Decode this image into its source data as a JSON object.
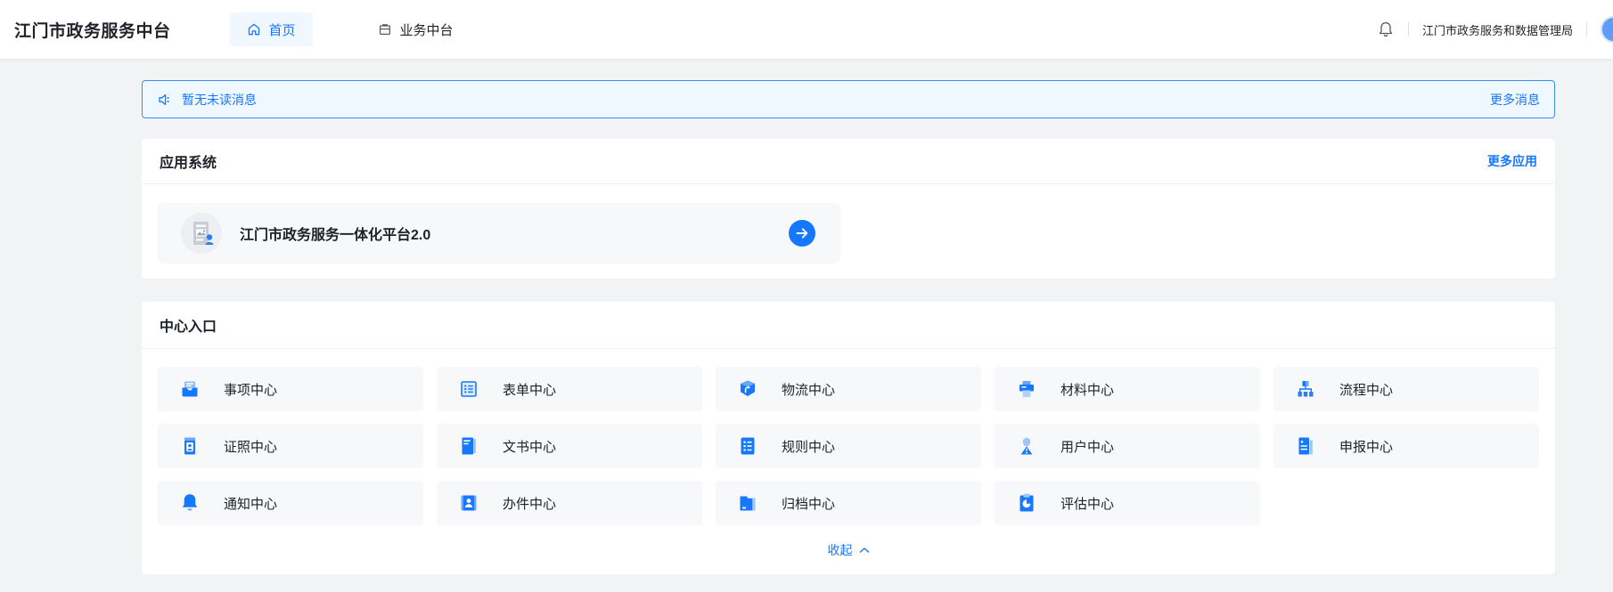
{
  "header": {
    "title": "江门市政务服务中台",
    "nav": [
      {
        "label": "首页",
        "icon": "home-icon",
        "active": true
      },
      {
        "label": "业务中台",
        "icon": "briefcase-icon",
        "active": false
      }
    ],
    "org_name": "江门市政务服务和数据管理局"
  },
  "notice_bar": {
    "message": "暂无未读消息",
    "more_label": "更多消息"
  },
  "app_section": {
    "title": "应用系统",
    "more_label": "更多应用",
    "apps": [
      {
        "name": "江门市政务服务一体化平台2.0",
        "icon": "platform-doc-icon",
        "action_icon": "arrow-right-circle-icon"
      }
    ]
  },
  "centers_section": {
    "title": "中心入口",
    "collapse_label": "收起",
    "items": [
      {
        "label": "事项中心",
        "icon": "inbox-icon"
      },
      {
        "label": "表单中心",
        "icon": "form-icon"
      },
      {
        "label": "物流中心",
        "icon": "cube-icon"
      },
      {
        "label": "材料中心",
        "icon": "printer-icon"
      },
      {
        "label": "流程中心",
        "icon": "flowchart-icon"
      },
      {
        "label": "证照中心",
        "icon": "id-card-icon"
      },
      {
        "label": "文书中心",
        "icon": "book-icon"
      },
      {
        "label": "规则中心",
        "icon": "rules-list-icon"
      },
      {
        "label": "用户中心",
        "icon": "user-icon"
      },
      {
        "label": "申报中心",
        "icon": "declare-doc-icon"
      },
      {
        "label": "通知中心",
        "icon": "bell-icon"
      },
      {
        "label": "办件中心",
        "icon": "badge-user-icon"
      },
      {
        "label": "归档中心",
        "icon": "folder-icon"
      },
      {
        "label": "评估中心",
        "icon": "clipboard-pie-icon"
      }
    ]
  },
  "colors": {
    "primary_blue": "#1677ff",
    "icon_light_blue": "#9ec6fb",
    "notice_bg": "#f0f8ff",
    "notice_border": "#3d8af2",
    "page_bg": "#f2f3f5",
    "item_bg": "#f7f8fa"
  }
}
